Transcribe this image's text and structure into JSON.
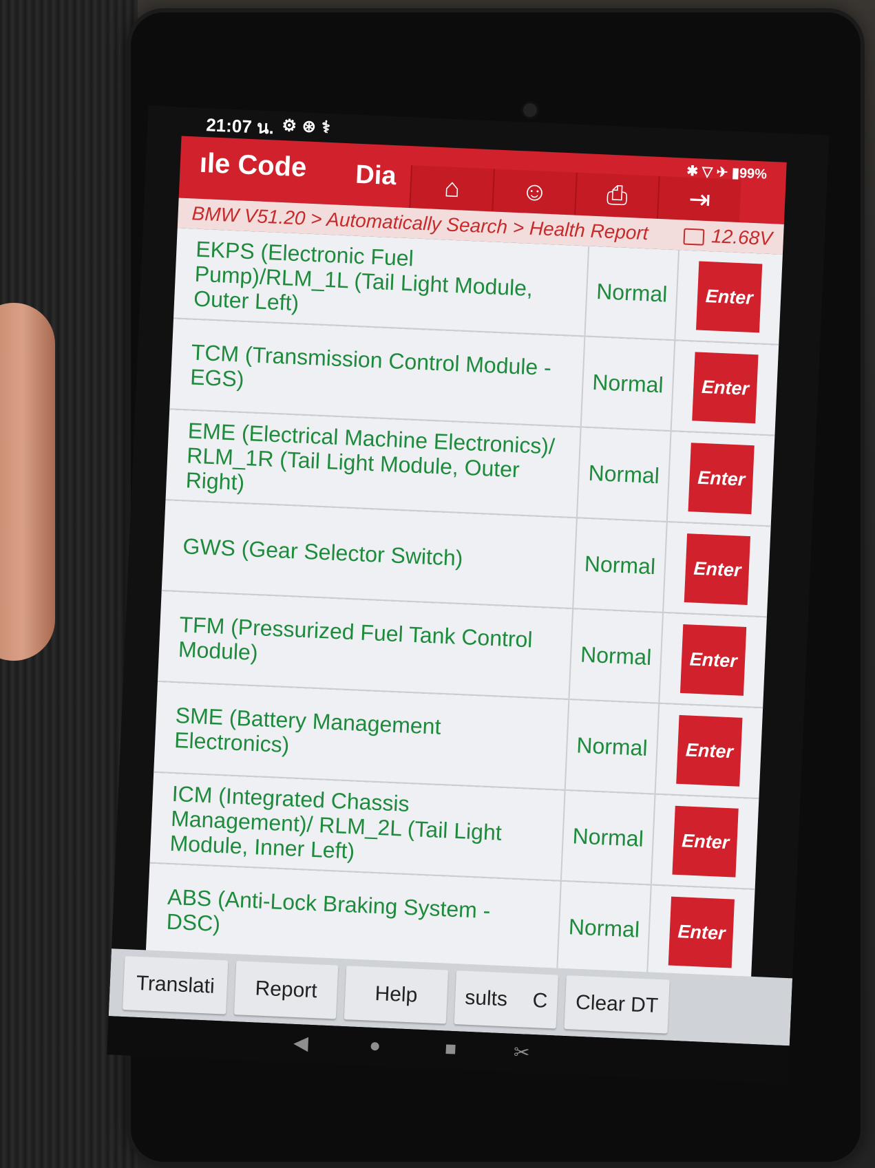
{
  "status_bar": {
    "time": "21:07 น.",
    "icons": [
      "settings-icon",
      "bluetooth-circle-icon",
      "stethoscope-icon"
    ],
    "battery": "99%"
  },
  "header": {
    "title_left": "ıle Code",
    "title_dia": "Dia",
    "buttons": [
      "home-icon",
      "support-agent-icon",
      "print-icon",
      "exit-icon"
    ]
  },
  "breadcrumb": {
    "path": "BMW V51.20 > Automatically Search > Health Report",
    "voltage": "12.68V"
  },
  "modules": [
    {
      "name": "EKPS (Electronic Fuel Pump)/RLM_1L (Tail Light Module, Outer Left)",
      "status": "Normal",
      "action": "Enter"
    },
    {
      "name": "TCM (Transmission Control Module - EGS)",
      "status": "Normal",
      "action": "Enter"
    },
    {
      "name": "EME (Electrical Machine Electronics)/ RLM_1R (Tail Light Module, Outer Right)",
      "status": "Normal",
      "action": "Enter"
    },
    {
      "name": "GWS (Gear Selector Switch)",
      "status": "Normal",
      "action": "Enter"
    },
    {
      "name": "TFM (Pressurized Fuel Tank Control Module)",
      "status": "Normal",
      "action": "Enter"
    },
    {
      "name": "SME (Battery Management Electronics)",
      "status": "Normal",
      "action": "Enter"
    },
    {
      "name": "ICM (Integrated Chassis Management)/ RLM_2L (Tail Light Module, Inner Left)",
      "status": "Normal",
      "action": "Enter"
    },
    {
      "name": "ABS (Anti-Lock Braking System - DSC)",
      "status": "Normal",
      "action": "Enter"
    }
  ],
  "toolbar": {
    "translation": "Translati",
    "report": "Report",
    "help": "Help",
    "results": "sults",
    "results_extra": "C",
    "clear_dtc": "Clear DT"
  },
  "colors": {
    "header_red": "#d0212c",
    "module_green": "#1e8a3c",
    "breadcrumb_red": "#c72a2a"
  }
}
